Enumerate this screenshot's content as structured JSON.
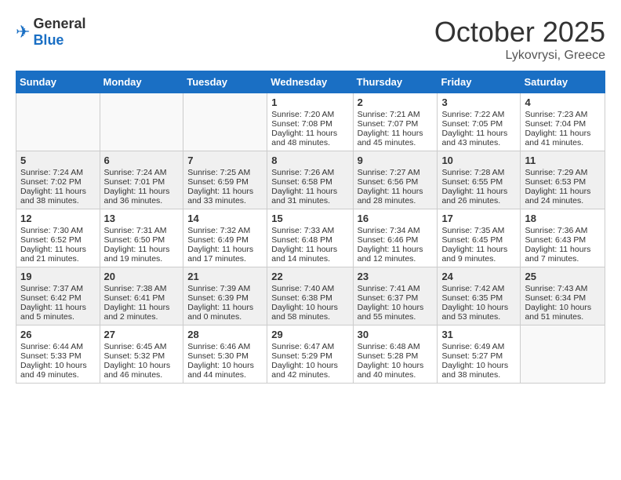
{
  "logo": {
    "general": "General",
    "blue": "Blue"
  },
  "title": "October 2025",
  "location": "Lykovrysi, Greece",
  "days_header": [
    "Sunday",
    "Monday",
    "Tuesday",
    "Wednesday",
    "Thursday",
    "Friday",
    "Saturday"
  ],
  "weeks": [
    [
      {
        "day": "",
        "info": ""
      },
      {
        "day": "",
        "info": ""
      },
      {
        "day": "",
        "info": ""
      },
      {
        "day": "1",
        "info": "Sunrise: 7:20 AM\nSunset: 7:08 PM\nDaylight: 11 hours\nand 48 minutes."
      },
      {
        "day": "2",
        "info": "Sunrise: 7:21 AM\nSunset: 7:07 PM\nDaylight: 11 hours\nand 45 minutes."
      },
      {
        "day": "3",
        "info": "Sunrise: 7:22 AM\nSunset: 7:05 PM\nDaylight: 11 hours\nand 43 minutes."
      },
      {
        "day": "4",
        "info": "Sunrise: 7:23 AM\nSunset: 7:04 PM\nDaylight: 11 hours\nand 41 minutes."
      }
    ],
    [
      {
        "day": "5",
        "info": "Sunrise: 7:24 AM\nSunset: 7:02 PM\nDaylight: 11 hours\nand 38 minutes."
      },
      {
        "day": "6",
        "info": "Sunrise: 7:24 AM\nSunset: 7:01 PM\nDaylight: 11 hours\nand 36 minutes."
      },
      {
        "day": "7",
        "info": "Sunrise: 7:25 AM\nSunset: 6:59 PM\nDaylight: 11 hours\nand 33 minutes."
      },
      {
        "day": "8",
        "info": "Sunrise: 7:26 AM\nSunset: 6:58 PM\nDaylight: 11 hours\nand 31 minutes."
      },
      {
        "day": "9",
        "info": "Sunrise: 7:27 AM\nSunset: 6:56 PM\nDaylight: 11 hours\nand 28 minutes."
      },
      {
        "day": "10",
        "info": "Sunrise: 7:28 AM\nSunset: 6:55 PM\nDaylight: 11 hours\nand 26 minutes."
      },
      {
        "day": "11",
        "info": "Sunrise: 7:29 AM\nSunset: 6:53 PM\nDaylight: 11 hours\nand 24 minutes."
      }
    ],
    [
      {
        "day": "12",
        "info": "Sunrise: 7:30 AM\nSunset: 6:52 PM\nDaylight: 11 hours\nand 21 minutes."
      },
      {
        "day": "13",
        "info": "Sunrise: 7:31 AM\nSunset: 6:50 PM\nDaylight: 11 hours\nand 19 minutes."
      },
      {
        "day": "14",
        "info": "Sunrise: 7:32 AM\nSunset: 6:49 PM\nDaylight: 11 hours\nand 17 minutes."
      },
      {
        "day": "15",
        "info": "Sunrise: 7:33 AM\nSunset: 6:48 PM\nDaylight: 11 hours\nand 14 minutes."
      },
      {
        "day": "16",
        "info": "Sunrise: 7:34 AM\nSunset: 6:46 PM\nDaylight: 11 hours\nand 12 minutes."
      },
      {
        "day": "17",
        "info": "Sunrise: 7:35 AM\nSunset: 6:45 PM\nDaylight: 11 hours\nand 9 minutes."
      },
      {
        "day": "18",
        "info": "Sunrise: 7:36 AM\nSunset: 6:43 PM\nDaylight: 11 hours\nand 7 minutes."
      }
    ],
    [
      {
        "day": "19",
        "info": "Sunrise: 7:37 AM\nSunset: 6:42 PM\nDaylight: 11 hours\nand 5 minutes."
      },
      {
        "day": "20",
        "info": "Sunrise: 7:38 AM\nSunset: 6:41 PM\nDaylight: 11 hours\nand 2 minutes."
      },
      {
        "day": "21",
        "info": "Sunrise: 7:39 AM\nSunset: 6:39 PM\nDaylight: 11 hours\nand 0 minutes."
      },
      {
        "day": "22",
        "info": "Sunrise: 7:40 AM\nSunset: 6:38 PM\nDaylight: 10 hours\nand 58 minutes."
      },
      {
        "day": "23",
        "info": "Sunrise: 7:41 AM\nSunset: 6:37 PM\nDaylight: 10 hours\nand 55 minutes."
      },
      {
        "day": "24",
        "info": "Sunrise: 7:42 AM\nSunset: 6:35 PM\nDaylight: 10 hours\nand 53 minutes."
      },
      {
        "day": "25",
        "info": "Sunrise: 7:43 AM\nSunset: 6:34 PM\nDaylight: 10 hours\nand 51 minutes."
      }
    ],
    [
      {
        "day": "26",
        "info": "Sunrise: 6:44 AM\nSunset: 5:33 PM\nDaylight: 10 hours\nand 49 minutes."
      },
      {
        "day": "27",
        "info": "Sunrise: 6:45 AM\nSunset: 5:32 PM\nDaylight: 10 hours\nand 46 minutes."
      },
      {
        "day": "28",
        "info": "Sunrise: 6:46 AM\nSunset: 5:30 PM\nDaylight: 10 hours\nand 44 minutes."
      },
      {
        "day": "29",
        "info": "Sunrise: 6:47 AM\nSunset: 5:29 PM\nDaylight: 10 hours\nand 42 minutes."
      },
      {
        "day": "30",
        "info": "Sunrise: 6:48 AM\nSunset: 5:28 PM\nDaylight: 10 hours\nand 40 minutes."
      },
      {
        "day": "31",
        "info": "Sunrise: 6:49 AM\nSunset: 5:27 PM\nDaylight: 10 hours\nand 38 minutes."
      },
      {
        "day": "",
        "info": ""
      }
    ]
  ]
}
